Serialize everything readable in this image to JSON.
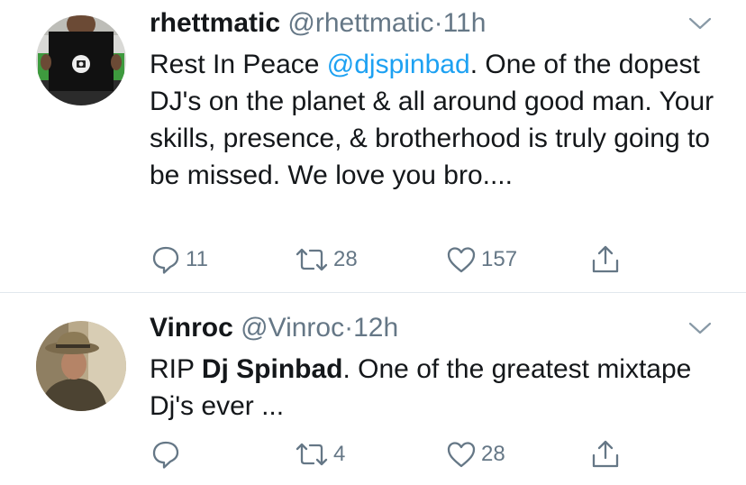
{
  "tweets": [
    {
      "name": "rhettmatic",
      "handle": "@rhettmatic",
      "dot": "·",
      "time": "11h",
      "text_parts": {
        "before": "Rest In Peace ",
        "mention": "@djspinbad",
        "after": ". One of the dopest DJ's on the planet & all around good man. Your skills, presence, & brotherhood is truly going to be missed. We love you bro...."
      },
      "counts": {
        "reply": "11",
        "retweet": "28",
        "like": "157",
        "share": ""
      }
    },
    {
      "name": "Vinroc",
      "handle": "@Vinroc",
      "dot": "·",
      "time": "12h",
      "text_parts": {
        "before": "RIP ",
        "bold": "Dj Spinbad",
        "after": ". One of the greatest mixtape Dj's ever ..."
      },
      "counts": {
        "reply": "",
        "retweet": "4",
        "like": "28",
        "share": ""
      }
    }
  ],
  "icons": {
    "reply": "speech-bubble-icon",
    "retweet": "retweet-arrows-icon",
    "like": "heart-outline-icon",
    "share": "share-upload-icon",
    "menu": "chevron-down-icon"
  },
  "colors": {
    "text": "#14171a",
    "secondary": "#657786",
    "link": "#1da1f2",
    "divider": "#e1e8ed"
  }
}
